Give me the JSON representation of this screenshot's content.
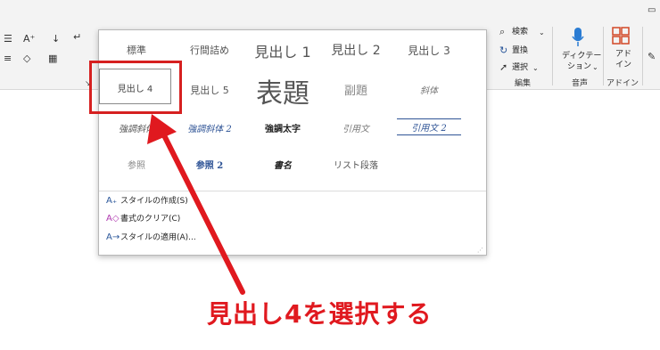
{
  "ribbon": {
    "search_label": "検索",
    "replace_label": "置換",
    "select_label": "選択",
    "edit_group": "編集",
    "dictation_line1": "ディクテー",
    "dictation_line2": "ション",
    "voice_group": "音声",
    "addin_line1": "アド",
    "addin_line2": "イン",
    "addin_group": "アドイン"
  },
  "gallery": {
    "row1": [
      "標準",
      "行間詰め",
      "見出し 1",
      "見出し 2",
      "見出し 3"
    ],
    "row2": [
      "見出し 4",
      "見出し 5",
      "表題",
      "副題",
      "斜体"
    ],
    "row3": [
      "強調斜体",
      "強調斜体 2",
      "強調太字",
      "引用文",
      "引用文 2"
    ],
    "row4": [
      "参照",
      "参照 2",
      "書名",
      "リスト段落"
    ],
    "menu": [
      {
        "label": "スタイルの作成(S)",
        "icon": "style-create-icon"
      },
      {
        "label": "書式のクリア(C)",
        "icon": "clear-format-icon"
      },
      {
        "label": "スタイルの適用(A)...",
        "icon": "apply-style-icon"
      }
    ]
  },
  "annotation": {
    "caption": "見出し4を選択する",
    "color": "#e0191f"
  }
}
